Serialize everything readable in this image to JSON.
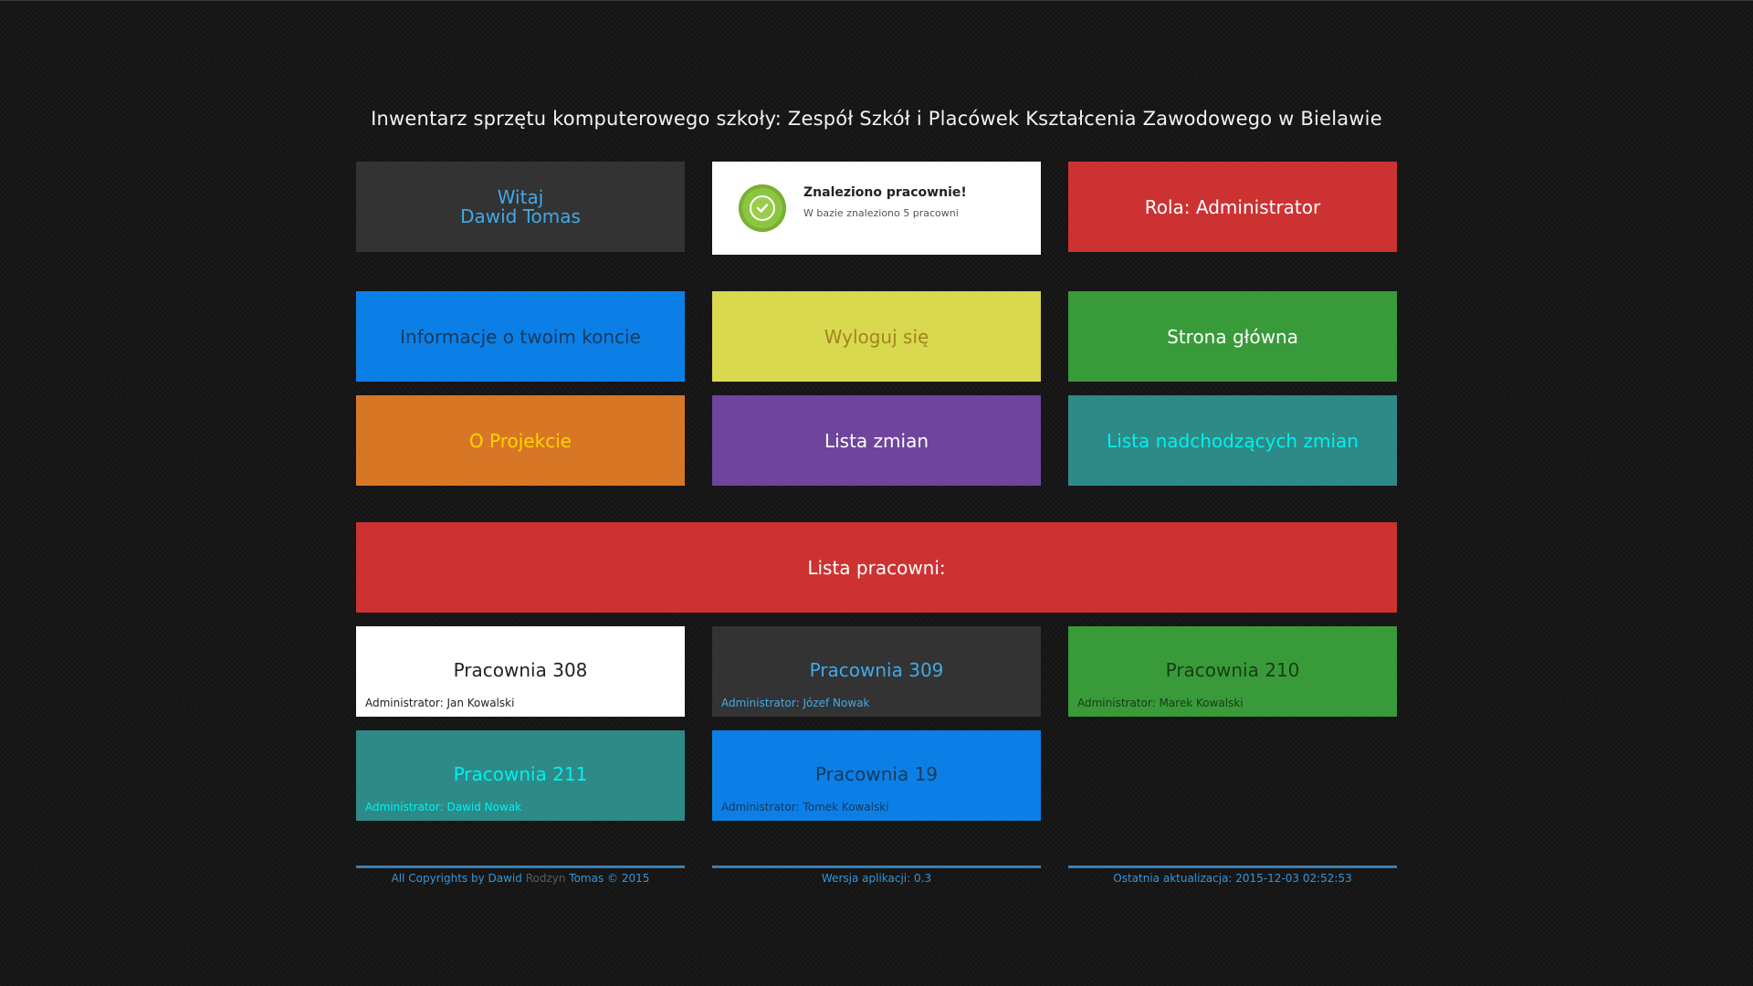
{
  "page": {
    "title": "Inwentarz sprzętu komputerowego szkoły: Zespół Szkół i Placówek Kształcenia Zawodowego w Bielawie"
  },
  "welcome": {
    "line1": "Witaj",
    "line2": "Dawid Tomas"
  },
  "notification": {
    "title": "Znaleziono pracownie!",
    "text": "W bazie znaleziono 5 pracowni",
    "icon": "check-circle-icon"
  },
  "role": {
    "label": "Rola: Administrator"
  },
  "menu": {
    "account": "Informacje o twoim koncie",
    "logout": "Wyloguj się",
    "home": "Strona główna",
    "about": "O Projekcie",
    "changelog": "Lista zmian",
    "upcoming": "Lista nadchodzących zmian"
  },
  "labs_header": "Lista pracowni:",
  "labs": [
    {
      "name": "Pracownia 308",
      "admin": "Administrator: Jan Kowalski"
    },
    {
      "name": "Pracownia 309",
      "admin": "Administrator: Józef Nowak"
    },
    {
      "name": "Pracownia 210",
      "admin": "Administrator: Marek Kowalski"
    },
    {
      "name": "Pracownia 211",
      "admin": "Administrator: Dawid Nowak"
    },
    {
      "name": "Pracownia 19",
      "admin": "Administrator: Tomek Kowalski"
    }
  ],
  "footer": {
    "copyright_pre": "All Copyrights by Dawid",
    "copyright_nick": "Rodzyn",
    "copyright_post": "Tomas © 2015",
    "version": "Wersja aplikacji: 0.3",
    "updated": "Ostatnia aktualizacja: 2015-12-03 02:52:53"
  },
  "colors": {
    "background": "#161616",
    "dark_tile": "#333333",
    "red": "#cd3232",
    "blue": "#0b7fe6",
    "yellow": "#d9d94f",
    "green": "#399a39",
    "orange": "#d77726",
    "purple": "#6f449c",
    "teal": "#2e8a87",
    "footer_accent": "#3795d6"
  }
}
